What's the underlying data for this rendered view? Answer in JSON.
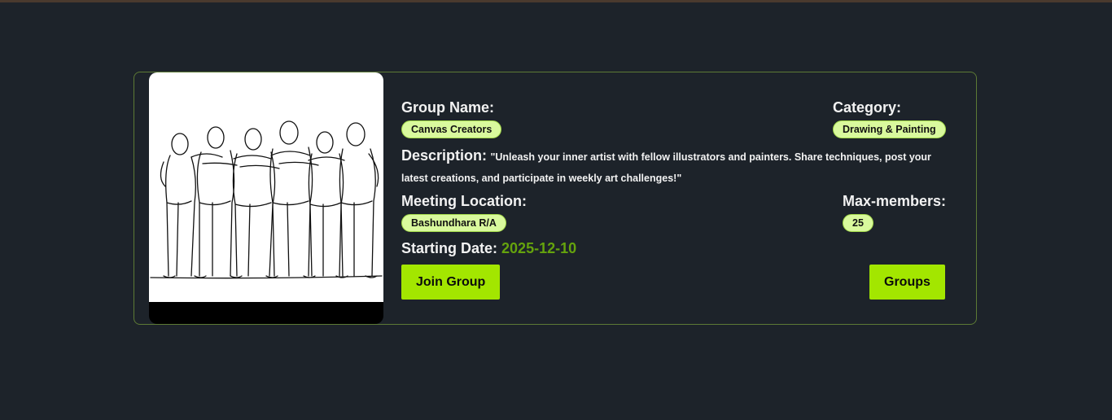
{
  "group": {
    "name_label": "Group Name:",
    "name": "Canvas Creators",
    "category_label": "Category:",
    "category": "Drawing & Painting",
    "description_label": "Description:",
    "description": "\"Unleash your inner artist with fellow illustrators and painters. Share techniques, post your latest creations, and participate in weekly art challenges!\"",
    "location_label": "Meeting Location:",
    "location": "Bashundhara R/A",
    "max_members_label": "Max-members:",
    "max_members": "25",
    "start_date_label": "Starting Date:",
    "start_date": "2025-12-10"
  },
  "image": {
    "icon": "people-line-art-icon"
  },
  "actions": {
    "join_label": "Join Group",
    "groups_label": "Groups"
  },
  "colors": {
    "background": "#1d232a",
    "accent": "#a3e600",
    "pill_bg": "#d9f99d",
    "date": "#65a30d",
    "card_border": "#5d7a35"
  }
}
